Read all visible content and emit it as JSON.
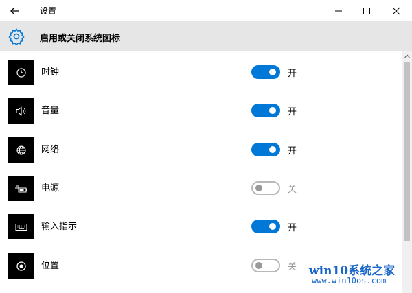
{
  "window": {
    "title": "设置",
    "back_icon": "arrow-left-icon",
    "minimize_icon": "minimize-icon",
    "maximize_icon": "maximize-icon",
    "close_icon": "close-icon"
  },
  "header": {
    "title": "启用或关闭系统图标",
    "icon": "gear-icon"
  },
  "colors": {
    "accent": "#0078d7",
    "tile": "#000000",
    "header_bg": "#e6e6e6",
    "off_text": "#9a9a9a"
  },
  "items": [
    {
      "label": "时钟",
      "icon": "clock-icon",
      "on": true,
      "state": "开"
    },
    {
      "label": "音量",
      "icon": "volume-icon",
      "on": true,
      "state": "开"
    },
    {
      "label": "网络",
      "icon": "globe-icon",
      "on": true,
      "state": "开"
    },
    {
      "label": "电源",
      "icon": "battery-plug-icon",
      "on": false,
      "state": "关"
    },
    {
      "label": "输入指示",
      "icon": "keyboard-icon",
      "on": true,
      "state": "开"
    },
    {
      "label": "位置",
      "icon": "location-icon",
      "on": false,
      "state": "关"
    }
  ],
  "watermark": {
    "line1": "win10系统之家",
    "line2": "www.win10os.com"
  }
}
